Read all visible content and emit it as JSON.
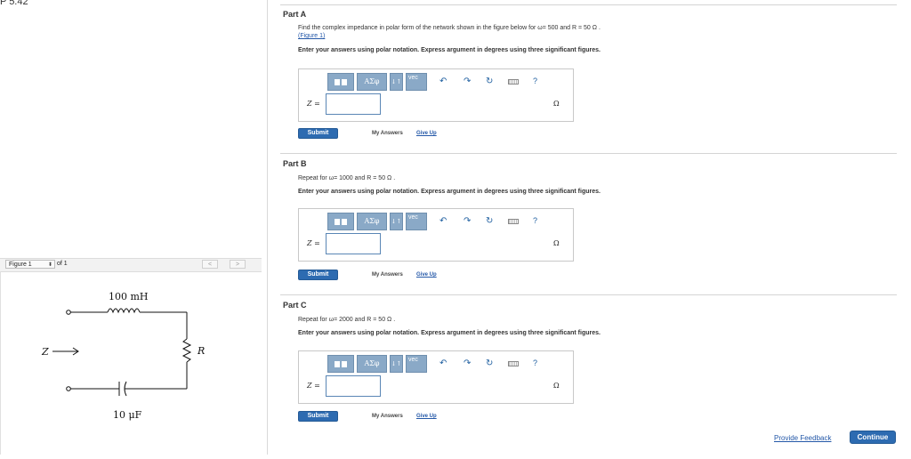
{
  "problem": {
    "title": "P 5.42"
  },
  "figure_panel": {
    "selected": "Figure 1",
    "of_text": "of 1",
    "prev": "<",
    "next": ">",
    "circuit": {
      "inductor_label": "100 mH",
      "capacitor_label": "10 μF",
      "resistor_label": "R",
      "terminal_label": "Z"
    }
  },
  "parts": [
    {
      "title": "Part A",
      "prompt": "Find the complex impedance in polar form of the network shown in the figure below for ω= 500 and R = 50 Ω .",
      "figure_link": "(Figure 1)",
      "instruction": "Enter your answers using polar notation. Express argument in degrees using three significant figures.",
      "answer_label": "Z =",
      "answer_value": "",
      "unit": "Ω",
      "submit_label": "Submit",
      "my_answers_label": "My Answers",
      "give_up_label": "Give Up"
    },
    {
      "title": "Part B",
      "prompt": "Repeat for ω= 1000 and R = 50 Ω .",
      "instruction": "Enter your answers using polar notation. Express argument in degrees using three significant figures.",
      "answer_label": "Z =",
      "answer_value": "",
      "unit": "Ω",
      "submit_label": "Submit",
      "my_answers_label": "My Answers",
      "give_up_label": "Give Up"
    },
    {
      "title": "Part C",
      "prompt": "Repeat for ω= 2000 and R = 50 Ω .",
      "instruction": "Enter your answers using polar notation. Express argument in degrees using three significant figures.",
      "answer_label": "Z =",
      "answer_value": "",
      "unit": "Ω",
      "submit_label": "Submit",
      "my_answers_label": "My Answers",
      "give_up_label": "Give Up"
    }
  ],
  "toolbar": {
    "greek_label": "ΑΣφ",
    "arrows_label": "↓↑",
    "vec_label": "vec",
    "undo_icon": "undo-icon",
    "redo_icon": "redo-icon",
    "reset_icon": "reset-icon",
    "keyboard_icon": "keyboard-icon",
    "help_label": "?"
  },
  "footer": {
    "feedback_label": "Provide Feedback",
    "continue_label": "Continue"
  },
  "colors": {
    "accent": "#2d6bb1",
    "toolbar_button": "#8aa9c7",
    "link": "#2458a8"
  }
}
